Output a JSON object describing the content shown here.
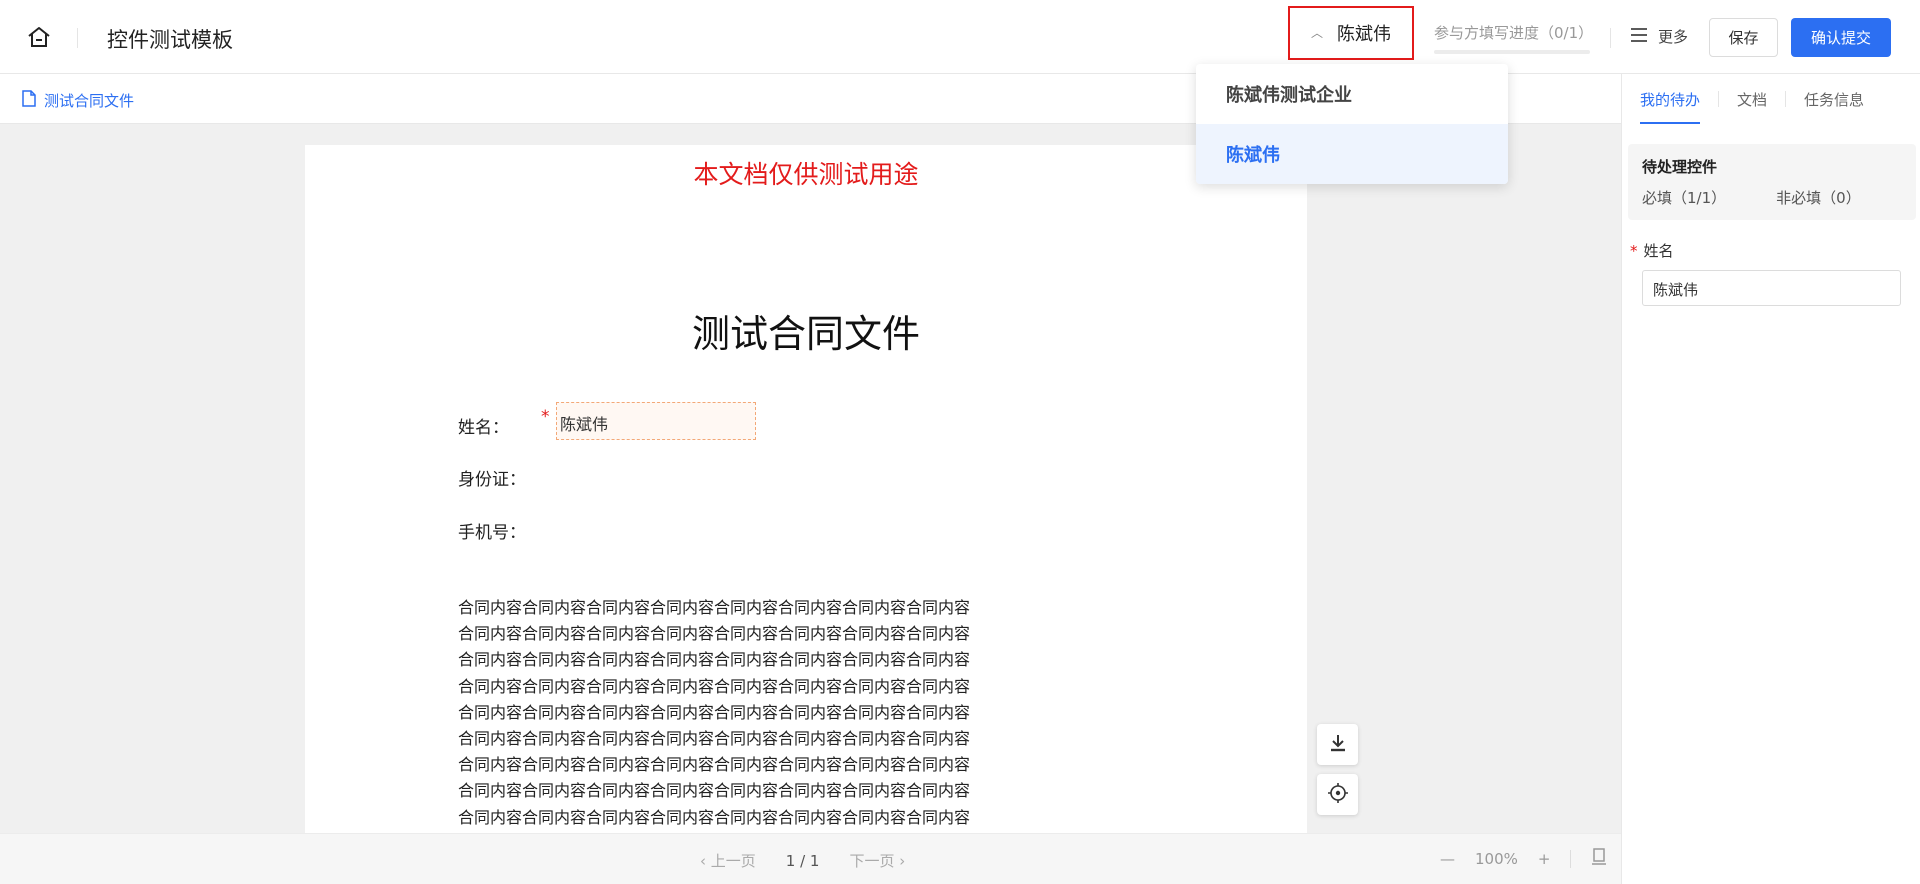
{
  "header": {
    "title": "控件测试模板",
    "signer": "陈斌伟",
    "progress_label": "参与方填写进度（0/1）",
    "progress_value": 0,
    "more_label": "更多",
    "save_label": "保存",
    "submit_label": "确认提交"
  },
  "subbar": {
    "doc_tab": "测试合同文件"
  },
  "document": {
    "watermark": "本文档仅供测试用途",
    "title": "测试合同文件",
    "fields": {
      "name_label": "姓名：",
      "name_value": "陈斌伟",
      "id_label": "身份证：",
      "phone_label": "手机号："
    },
    "paragraph_lines": [
      "合同内容合同内容合同内容合同内容合同内容合同内容合同内容合同内容",
      "合同内容合同内容合同内容合同内容合同内容合同内容合同内容合同内容",
      "合同内容合同内容合同内容合同内容合同内容合同内容合同内容合同内容",
      "合同内容合同内容合同内容合同内容合同内容合同内容合同内容合同内容",
      "合同内容合同内容合同内容合同内容合同内容合同内容合同内容合同内容",
      "合同内容合同内容合同内容合同内容合同内容合同内容合同内容合同内容",
      "合同内容合同内容合同内容合同内容合同内容合同内容合同内容合同内容",
      "合同内容合同内容合同内容合同内容合同内容合同内容合同内容合同内容",
      "合同内容合同内容合同内容合同内容合同内容合同内容合同内容合同内容"
    ]
  },
  "footer": {
    "prev_label": "上一页",
    "page_indicator": "1 / 1",
    "next_label": "下一页",
    "zoom": "100%"
  },
  "right_panel": {
    "tabs": [
      "我的待办",
      "文档",
      "任务信息"
    ],
    "todo_title": "待处理控件",
    "required_count": "必填（1/1）",
    "optional_count": "非必填（0）",
    "field_label": "姓名",
    "field_value": "陈斌伟"
  },
  "dropdown": {
    "items": [
      "陈斌伟测试企业",
      "陈斌伟"
    ],
    "selected": "陈斌伟"
  },
  "colors": {
    "accent": "#2c6ff2",
    "required_red": "#e31b1b",
    "highlight_border": "#e31b1b"
  }
}
